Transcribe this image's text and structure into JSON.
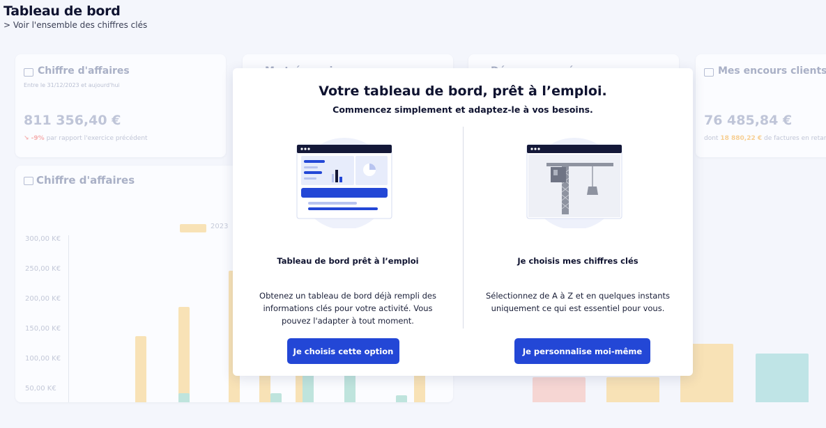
{
  "header": {
    "title": "Tableau de bord",
    "subtitle": "> Voir l'ensemble des chiffres clés"
  },
  "cards": {
    "revenue": {
      "title": "Chiffre d'affaires",
      "subtitle": "Entre le 31/12/2023 et aujourd'hui",
      "value": "811 356,40 €",
      "delta_value": "↘ -9%",
      "delta_text": "par rapport l'exercice précédent"
    },
    "card2_title": "Ma trésorerie",
    "card3_title": "Dépenses payées",
    "outstanding": {
      "title": "Mes encours clients",
      "value": "76 485,84 €",
      "prefix": "dont",
      "highlight": "18 880,22 €",
      "suffix": "de factures en retard"
    }
  },
  "chart": {
    "title": "Chiffre d'affaires",
    "legend": "2023",
    "yticks": [
      "300,00 K€",
      "250,00 K€",
      "200,00 K€",
      "150,00 K€",
      "100,00 K€",
      "50,00 K€"
    ]
  },
  "chart_data": {
    "type": "bar",
    "title": "Chiffre d'affaires",
    "ylim": [
      0,
      300
    ],
    "series": [
      {
        "name": "2023",
        "values": [
          122,
          176,
          242,
          100,
          160,
          51
        ]
      },
      {
        "values": [
          48,
          46,
          160,
          160,
          36
        ]
      }
    ]
  },
  "modal": {
    "title": "Votre tableau de bord, prêt à l’emploi.",
    "subtitle": "Commencez simplement et adaptez-le à vos besoins.",
    "left": {
      "title": "Tableau de bord prêt à l’emploi",
      "desc1": "Obtenez un tableau de bord déjà rempli des",
      "desc2": "informations clés pour votre activité. Vous",
      "desc3": "pouvez l'adapter à tout moment.",
      "button": "Je choisis cette option"
    },
    "right": {
      "title": "Je choisis mes chiffres clés",
      "desc1": "Sélectionnez de A à Z et en quelques instants",
      "desc2": "uniquement ce qui est essentiel pour vous.",
      "button": "Je personnalise moi-même"
    }
  },
  "colors": {
    "primary": "#2347d6",
    "navy": "#0f1330",
    "bar_2023": "#f8e2b6",
    "bar_teal": "#bfe4dd"
  }
}
